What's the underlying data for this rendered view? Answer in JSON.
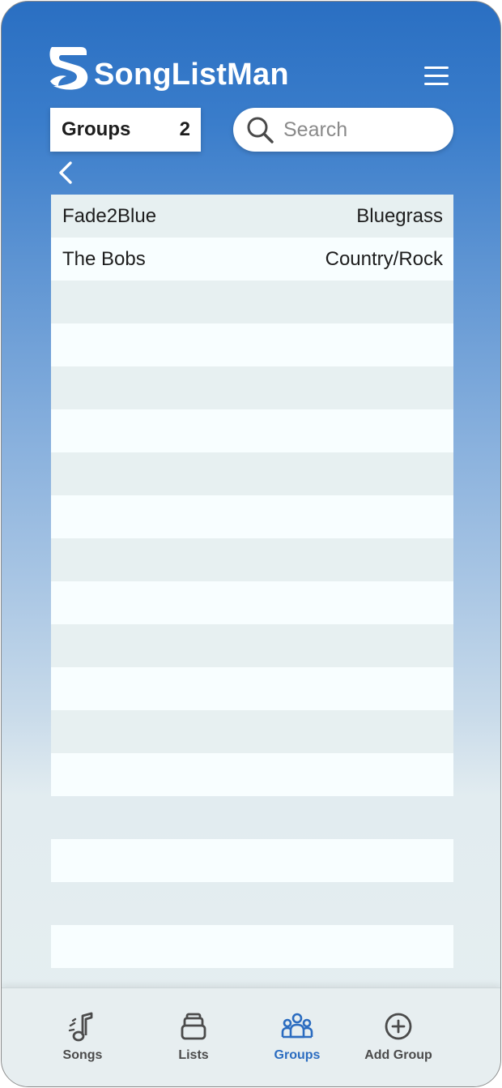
{
  "app": {
    "name": "SongListMan"
  },
  "colors": {
    "brand_blue": "#2b6cc0",
    "row_alt": "#e7f0f1",
    "row_base": "#f8feff"
  },
  "groups_box": {
    "label": "Groups",
    "count": "2"
  },
  "search": {
    "placeholder": "Search",
    "value": ""
  },
  "groups": [
    {
      "name": "Fade2Blue",
      "genre": "Bluegrass"
    },
    {
      "name": "The Bobs",
      "genre": "Country/Rock"
    }
  ],
  "nav": {
    "items": [
      {
        "label": "Songs",
        "icon": "music-note-icon",
        "active": false
      },
      {
        "label": "Lists",
        "icon": "stack-icon",
        "active": false
      },
      {
        "label": "Groups",
        "icon": "people-icon",
        "active": true
      },
      {
        "label": "Add Group",
        "icon": "plus-circle-icon",
        "active": false
      }
    ]
  }
}
